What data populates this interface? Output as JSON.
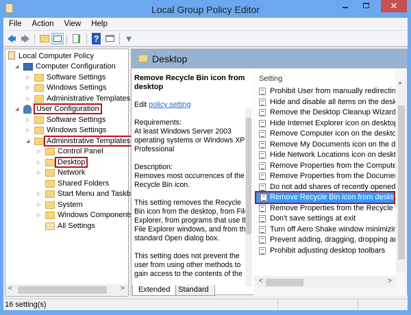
{
  "window": {
    "title": "Local Group Policy Editor",
    "close": "✕"
  },
  "menu": [
    "File",
    "Action",
    "View",
    "Help"
  ],
  "toolbar": [
    "back-icon",
    "forward-icon",
    "up-folder-icon",
    "show-hide-tree-icon",
    "export-list-icon",
    "help-icon",
    "show-action-pane-icon",
    "filter-icon"
  ],
  "tree": [
    {
      "label": "Local Computer Policy",
      "level": 0
    },
    {
      "label": "Computer Configuration",
      "level": 1,
      "expanded": true
    },
    {
      "label": "Software Settings",
      "level": 2
    },
    {
      "label": "Windows Settings",
      "level": 2
    },
    {
      "label": "Administrative Templates",
      "level": 2
    },
    {
      "label": "User Configuration",
      "level": 1,
      "expanded": true,
      "highlighted": true
    },
    {
      "label": "Software Settings",
      "level": 2
    },
    {
      "label": "Windows Settings",
      "level": 2
    },
    {
      "label": "Administrative Templates",
      "level": 2,
      "expanded": true,
      "highlighted": true
    },
    {
      "label": "Control Panel",
      "level": 3
    },
    {
      "label": "Desktop",
      "level": 3,
      "selected": true,
      "highlighted": true
    },
    {
      "label": "Network",
      "level": 3
    },
    {
      "label": "Shared Folders",
      "level": 3
    },
    {
      "label": "Start Menu and Taskbar",
      "level": 3
    },
    {
      "label": "System",
      "level": 3
    },
    {
      "label": "Windows Components",
      "level": 3
    },
    {
      "label": "All Settings",
      "level": 3
    }
  ],
  "details": {
    "header": "Desktop",
    "title": "Remove Recycle Bin icon from desktop",
    "edit_prefix": "Edit",
    "edit_link": "policy setting",
    "requirements_label": "Requirements:",
    "requirements": "At least Windows Server 2003 operating systems or Windows XP Professional",
    "description_label": "Description:",
    "description": "Removes most occurrences of the Recycle Bin icon.",
    "para1": "This setting removes the Recycle Bin icon from the desktop, from File Explorer, from programs that use the File Explorer windows, and from the standard Open dialog box.",
    "para2": "This setting does not prevent the user from using other methods to gain access to the contents of the"
  },
  "settings": {
    "column": "Setting",
    "items": [
      "Prohibit User from manually redirecting Profile Folders",
      "Hide and disable all items on the desktop",
      "Remove the Desktop Cleanup Wizard",
      "Hide Internet Explorer icon on desktop",
      "Remove Computer icon on the desktop",
      "Remove My Documents icon on the desktop",
      "Hide Network Locations icon on desktop",
      "Remove Properties from the Computer icon context menu",
      "Remove Properties from the Documents icon context menu",
      "Do not add shares of recently opened documents to Network Locations",
      "Remove Recycle Bin icon from desktop",
      "Remove Properties from the Recycle Bin context menu",
      "Don't save settings at exit",
      "Turn off Aero Shake window minimizing mouse gesture",
      "Prevent adding, dragging, dropping and closing the Taskbar's toolbars",
      "Prohibit adjusting desktop toolbars"
    ],
    "selected_index": 10
  },
  "tabs": [
    "Extended",
    "Standard"
  ],
  "status": "16 setting(s)"
}
